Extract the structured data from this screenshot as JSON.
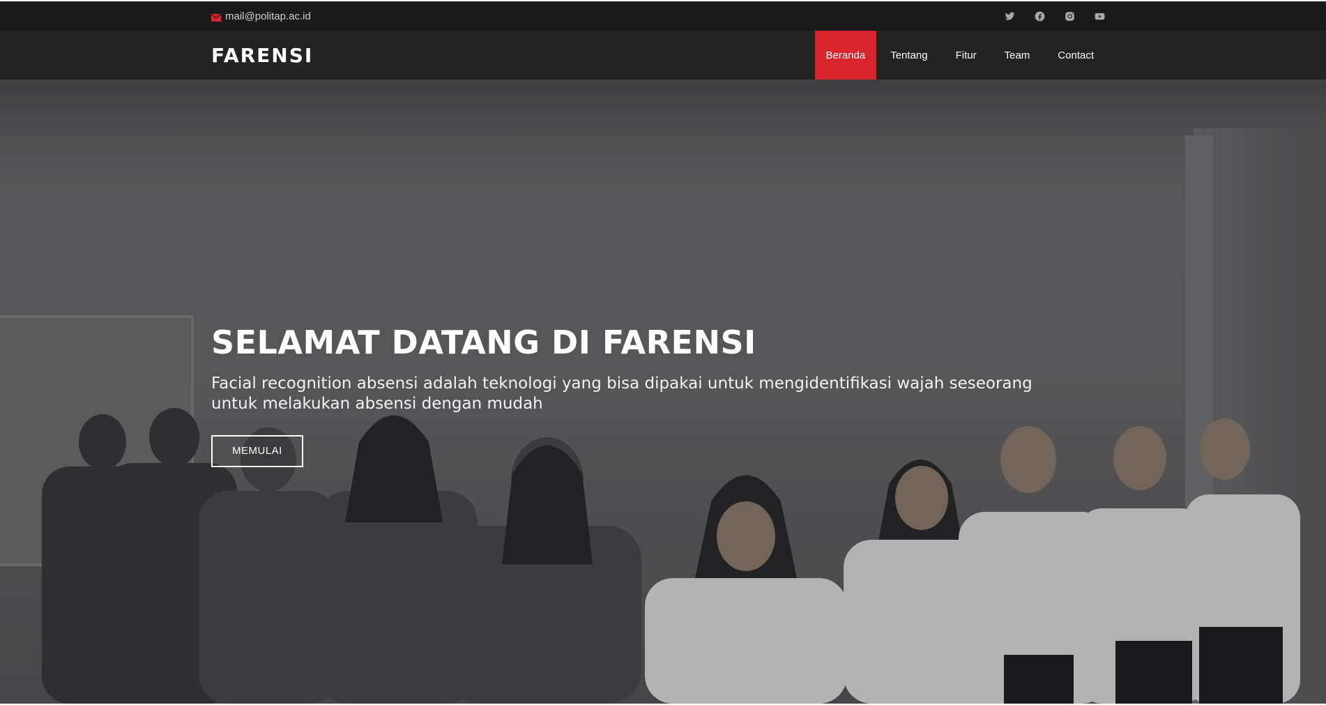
{
  "topbar": {
    "email": "mail@politap.ac.id",
    "icons": [
      "mail-icon",
      "twitter-icon",
      "facebook-icon",
      "instagram-icon",
      "youtube-icon"
    ]
  },
  "navbar": {
    "logo": "FARENSI",
    "menu": [
      {
        "label": "Beranda",
        "active": true
      },
      {
        "label": "Tentang",
        "active": false
      },
      {
        "label": "Fitur",
        "active": false
      },
      {
        "label": "Team",
        "active": false
      },
      {
        "label": "Contact",
        "active": false
      }
    ]
  },
  "hero": {
    "title": "SELAMAT DATANG DI FARENSI",
    "subtitle": "Facial recognition absensi adalah teknologi yang bisa dipakai untuk mengidentifikasi wajah seseorang untuk melakukan absensi dengan mudah",
    "button": "MEMULAI"
  },
  "colors": {
    "accent": "#d9232d",
    "topbar_bg": "#1b1b1b",
    "navbar_bg": "#232323"
  }
}
